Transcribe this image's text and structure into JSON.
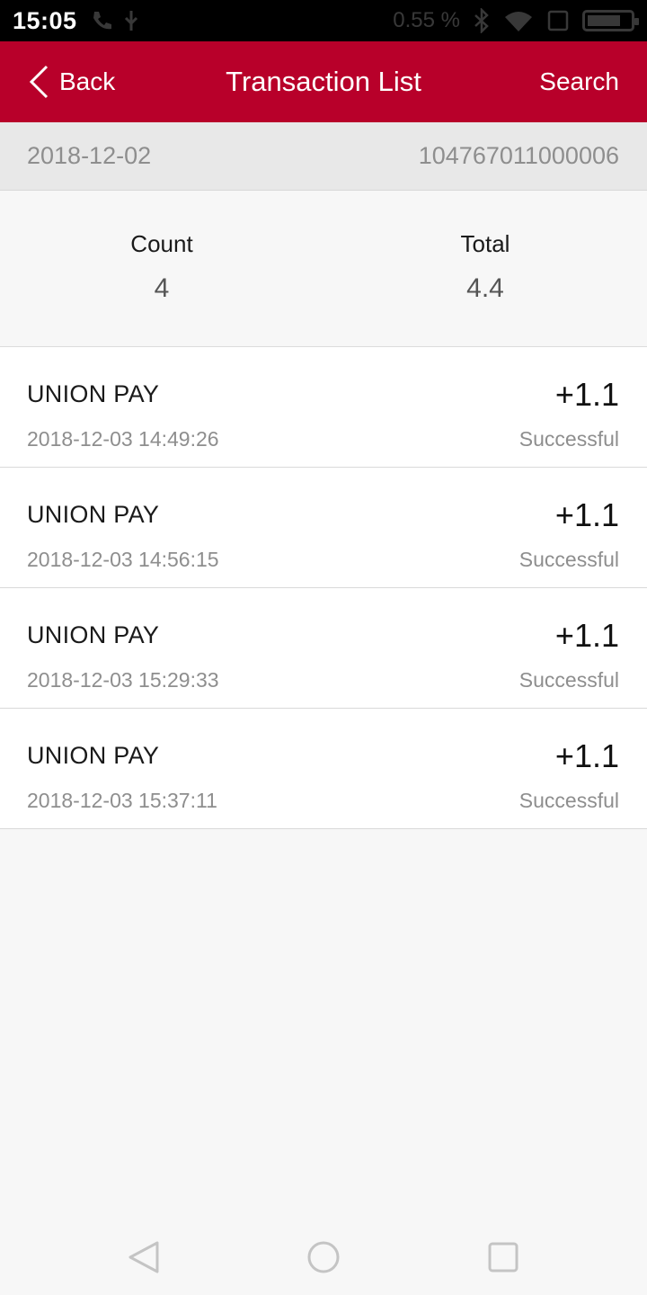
{
  "status_bar": {
    "time": "15:05",
    "ghost_text": "0.55 %"
  },
  "header": {
    "back_label": "Back",
    "title": "Transaction List",
    "search_label": "Search"
  },
  "info": {
    "date": "2018-12-02",
    "merchant_id": "104767011000006"
  },
  "summary": {
    "count_label": "Count",
    "count_value": "4",
    "total_label": "Total",
    "total_value": "4.4"
  },
  "transactions": [
    {
      "name": "UNION PAY",
      "time": "2018-12-03 14:49:26",
      "amount": "+1.1",
      "status": "Successful"
    },
    {
      "name": "UNION PAY",
      "time": "2018-12-03 14:56:15",
      "amount": "+1.1",
      "status": "Successful"
    },
    {
      "name": "UNION PAY",
      "time": "2018-12-03 15:29:33",
      "amount": "+1.1",
      "status": "Successful"
    },
    {
      "name": "UNION PAY",
      "time": "2018-12-03 15:37:11",
      "amount": "+1.1",
      "status": "Successful"
    }
  ],
  "colors": {
    "brand": "#b8002a",
    "background": "#f7f7f7"
  },
  "icons": {
    "back": "chevron-left-icon",
    "nav_back": "triangle-back-icon",
    "nav_home": "circle-home-icon",
    "nav_recents": "square-recents-icon"
  }
}
